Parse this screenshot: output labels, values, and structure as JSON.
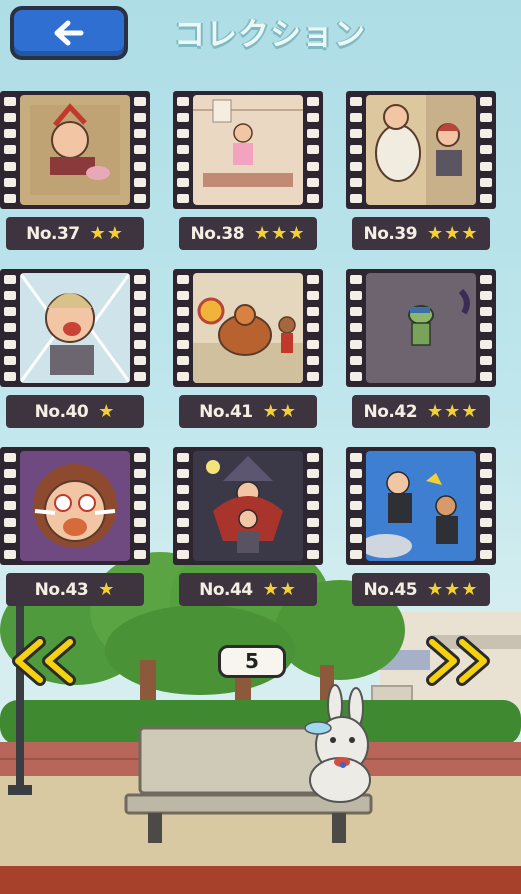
{
  "header": {
    "title": "コレクション",
    "back_icon": "arrow-left-icon"
  },
  "collection": {
    "items": [
      {
        "number": "No.37",
        "stars": "★★",
        "rating": 2,
        "rating_max": 3
      },
      {
        "number": "No.38",
        "stars": "★★★",
        "rating": 3,
        "rating_max": 3
      },
      {
        "number": "No.39",
        "stars": "★★★",
        "rating": 3,
        "rating_max": 3
      },
      {
        "number": "No.40",
        "stars": "★",
        "rating": 1,
        "rating_max": 3
      },
      {
        "number": "No.41",
        "stars": "★★",
        "rating": 2,
        "rating_max": 3
      },
      {
        "number": "No.42",
        "stars": "★★★",
        "rating": 3,
        "rating_max": 3
      },
      {
        "number": "No.43",
        "stars": "★",
        "rating": 1,
        "rating_max": 3
      },
      {
        "number": "No.44",
        "stars": "★★",
        "rating": 2,
        "rating_max": 3
      },
      {
        "number": "No.45",
        "stars": "★★★",
        "rating": 3,
        "rating_max": 3
      }
    ]
  },
  "pagination": {
    "page": "5",
    "prev_icon": "double-chevron-left-icon",
    "next_icon": "double-chevron-right-icon"
  },
  "colors": {
    "accent_button": "#2f6fd1",
    "star": "#f2d036",
    "nav_arrow": "#f4d20f",
    "film": "#2d2530",
    "label_bg": "#3d3440"
  }
}
